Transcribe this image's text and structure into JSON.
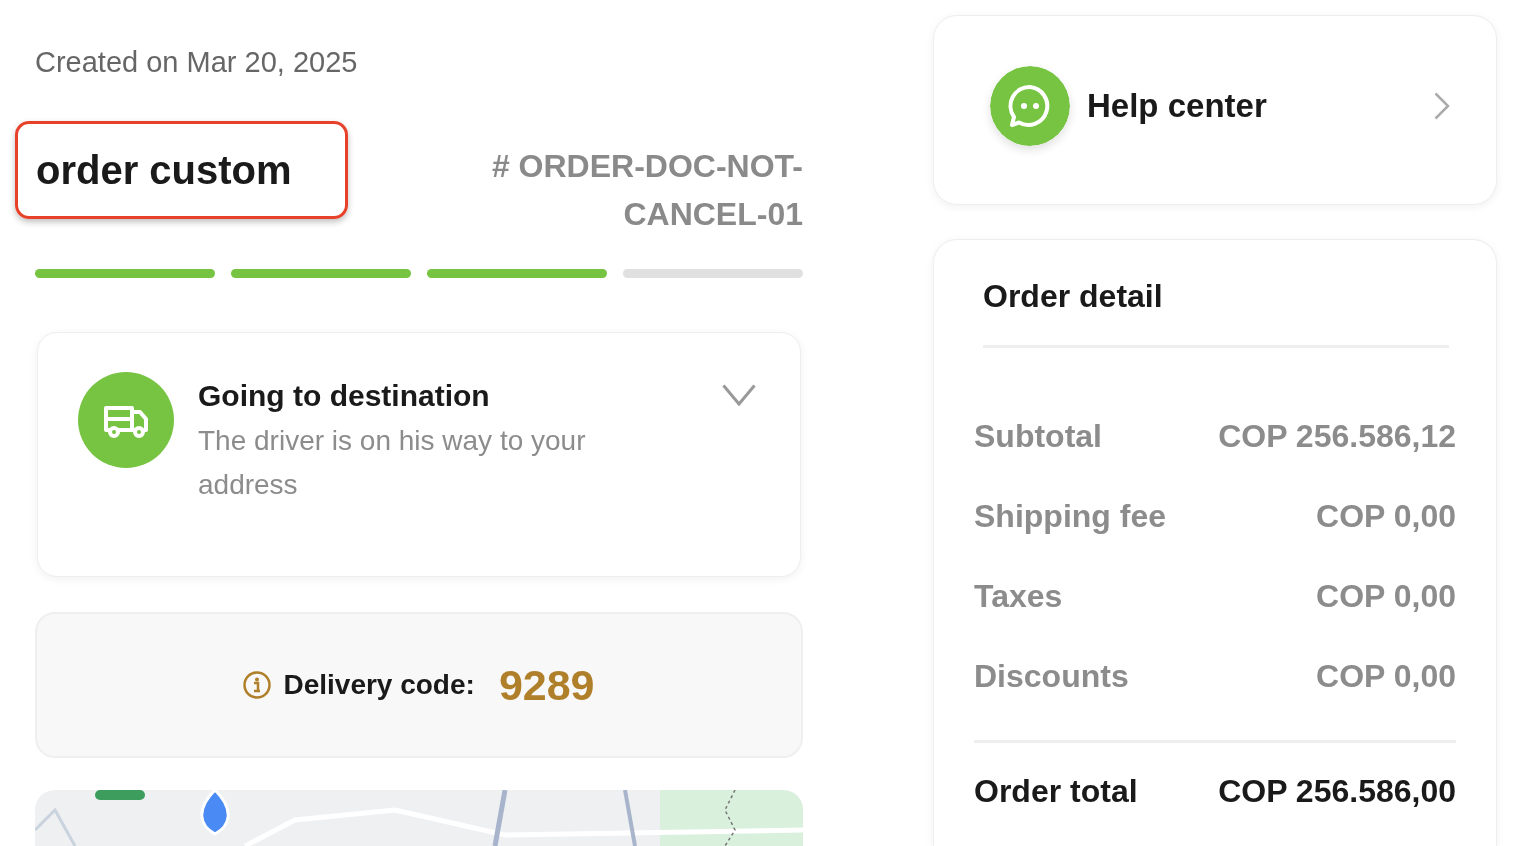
{
  "order": {
    "created": "Created on Mar 20, 2025",
    "title": "order custom",
    "title_highlighted": true,
    "number": "# ORDER-DOC-NOT-CANCEL-01"
  },
  "progress_steps": [
    {
      "completed": true
    },
    {
      "completed": true
    },
    {
      "completed": true
    },
    {
      "completed": false
    }
  ],
  "status": {
    "title": "Going to destination",
    "description": "The driver is on his way to your address",
    "expanded": false
  },
  "delivery_code": {
    "label": "Delivery code:",
    "code": "9289"
  },
  "help_center": {
    "label": "Help center"
  },
  "order_detail": {
    "title": "Order detail",
    "lines": [
      {
        "label": "Subtotal",
        "value": "COP 256.586,12"
      },
      {
        "label": "Shipping fee",
        "value": "COP 0,00"
      },
      {
        "label": "Taxes",
        "value": "COP 0,00"
      },
      {
        "label": "Discounts",
        "value": "COP 0,00"
      }
    ],
    "total": {
      "label": "Order total",
      "value": "COP 256.586,00"
    }
  }
}
